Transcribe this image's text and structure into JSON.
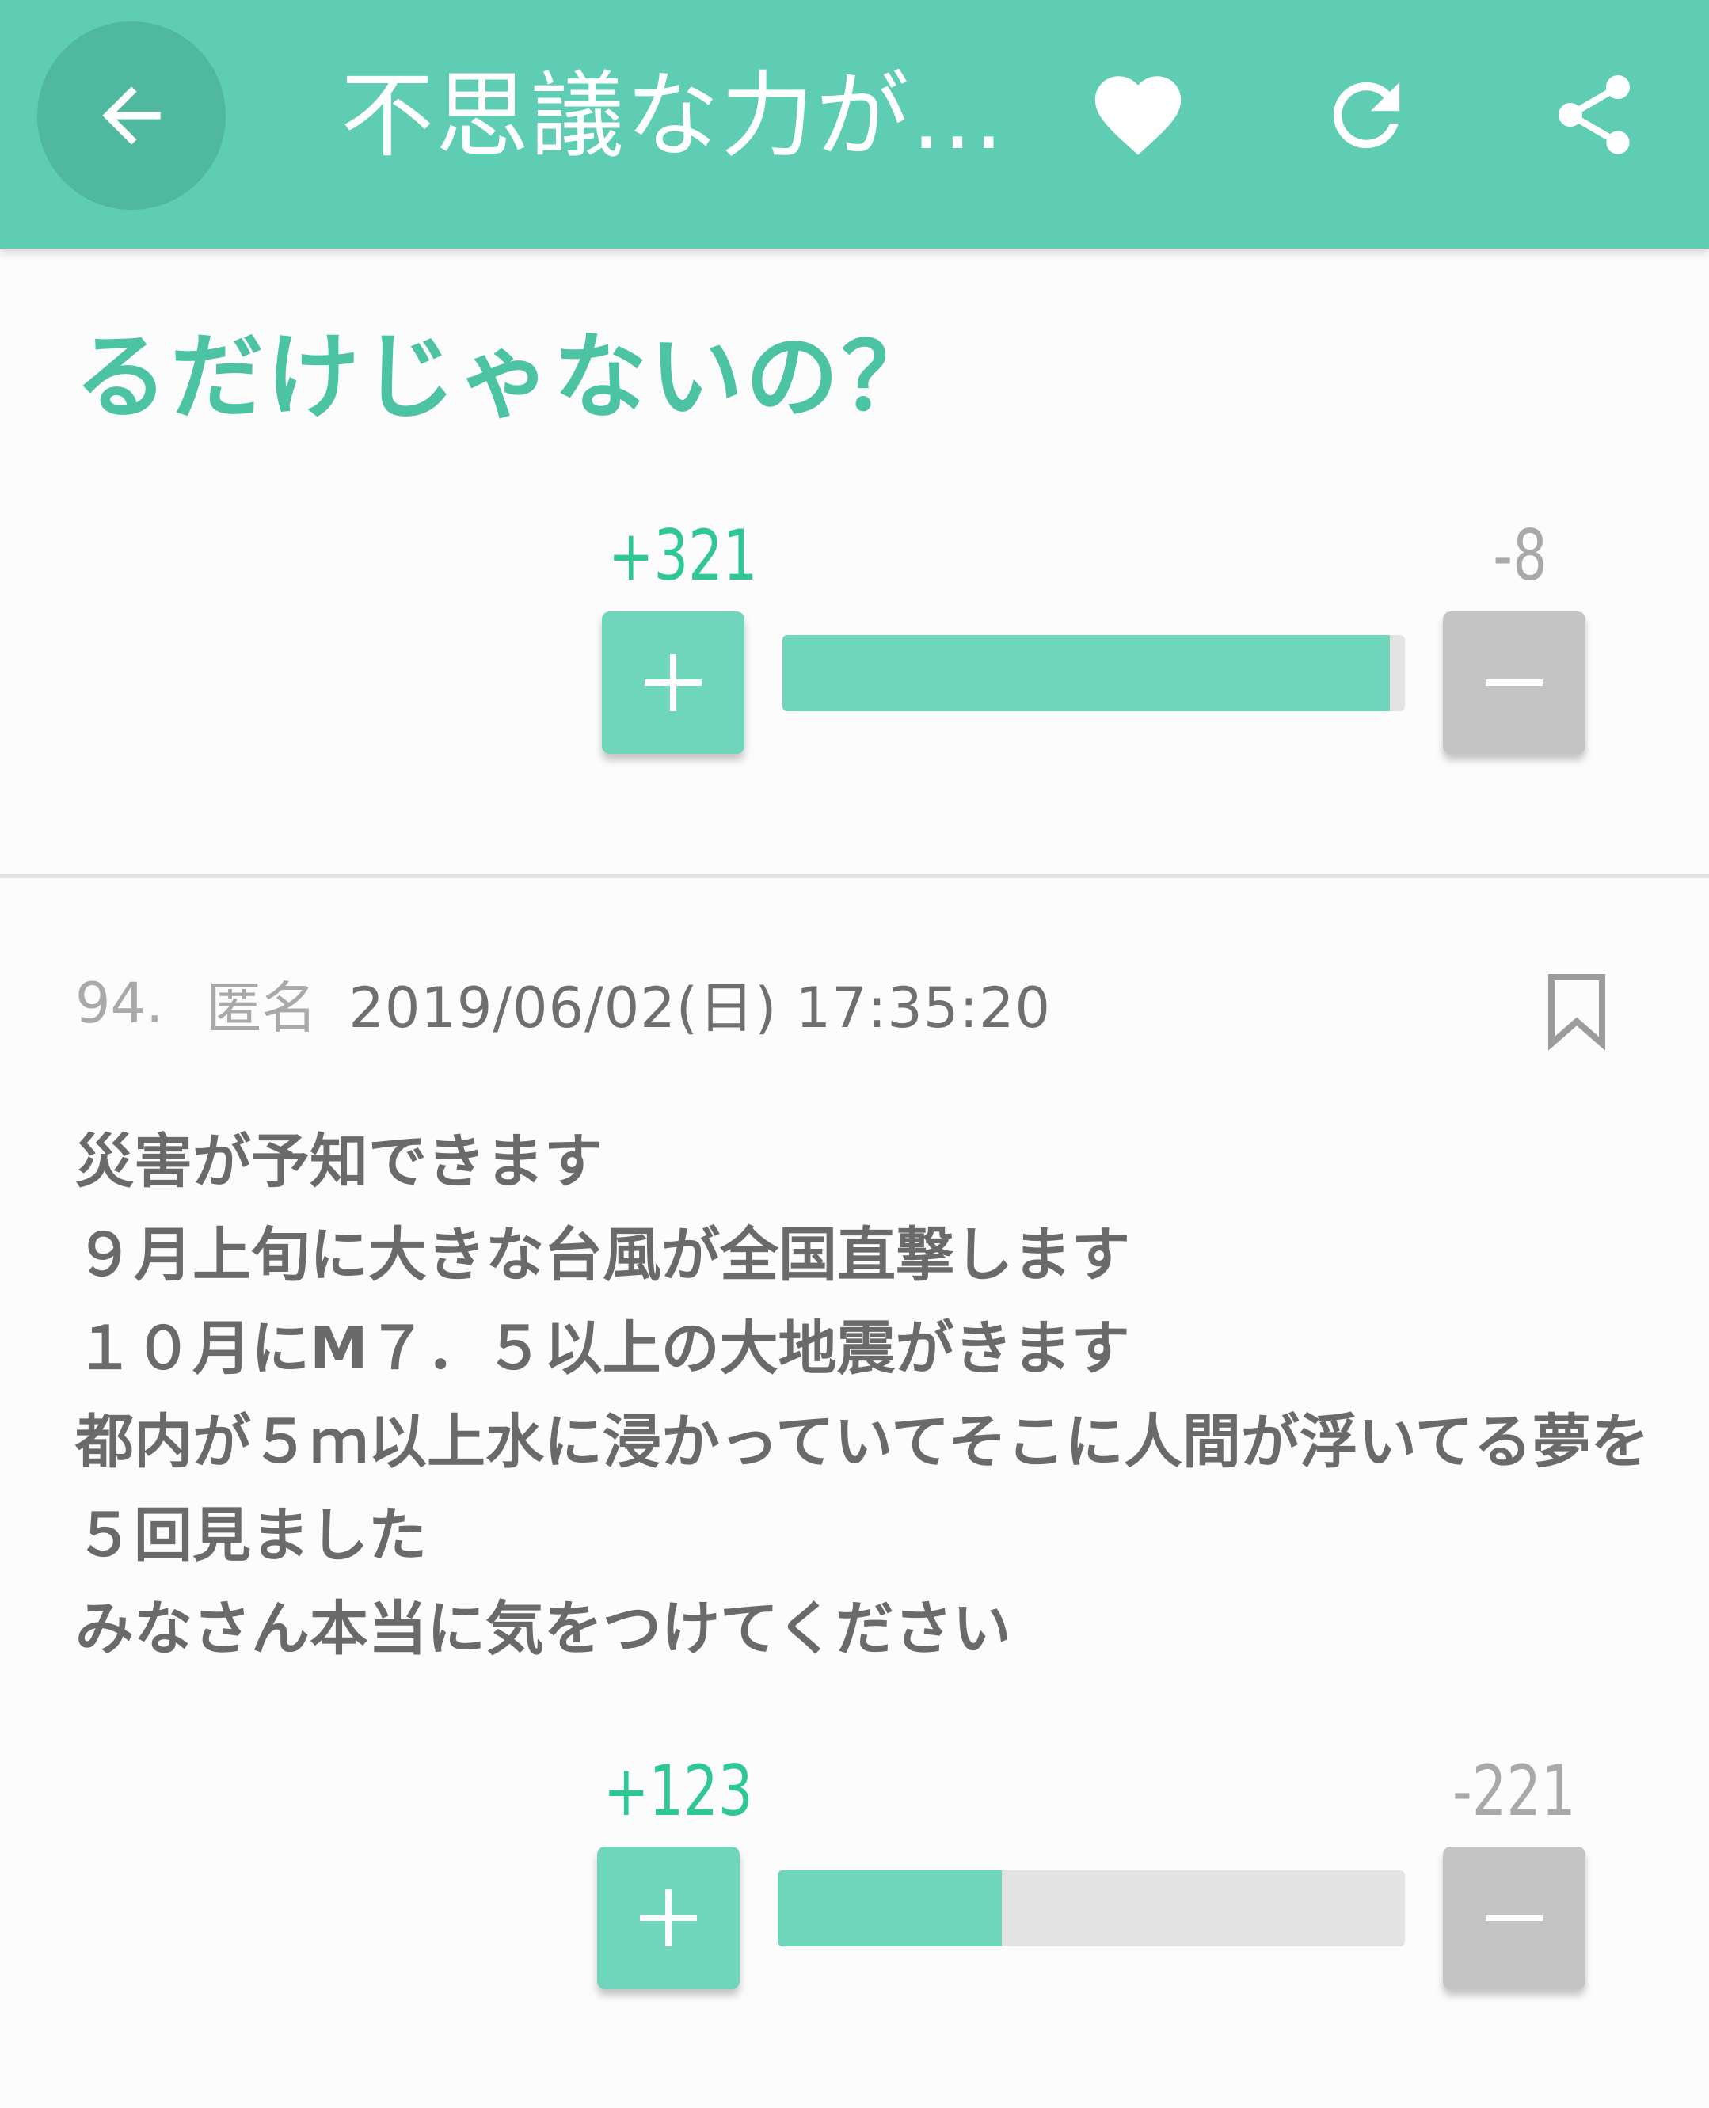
{
  "appbar": {
    "title": "不思議な力が…",
    "accent": "#5ecdb3"
  },
  "prev_comment": {
    "tail_text": "るだけじゃないの？",
    "votes": {
      "plus": "+321",
      "minus": "-8",
      "plus_ratio": 0.9757
    }
  },
  "comment": {
    "number": "94.",
    "author": "匿名",
    "date": "2019/06/02(日) 17:35:20",
    "lines": [
      "災害が予知できます",
      "９月上旬に大きな台風が全国直撃します",
      "１０月にM７．５以上の大地震がきます",
      "都内が５ｍ以上水に浸かっていてそこに人間が浮いてる夢を",
      "５回見ました",
      "みなさん本当に気をつけてください"
    ],
    "votes": {
      "plus": "+123",
      "minus": "-221",
      "plus_ratio": 0.3576
    }
  },
  "icons": {
    "back": "arrow-left-icon",
    "heart": "heart-icon",
    "refresh": "refresh-icon",
    "share": "share-icon",
    "bookmark": "bookmark-icon",
    "plus": "plus-icon",
    "minus": "minus-icon"
  },
  "colors": {
    "plus_green": "#2fc796",
    "fill_green": "#6fd6bc",
    "minus_gray": "#c4c4c4",
    "track_gray": "#e3e3e3",
    "body_text": "#6a6a6a"
  }
}
